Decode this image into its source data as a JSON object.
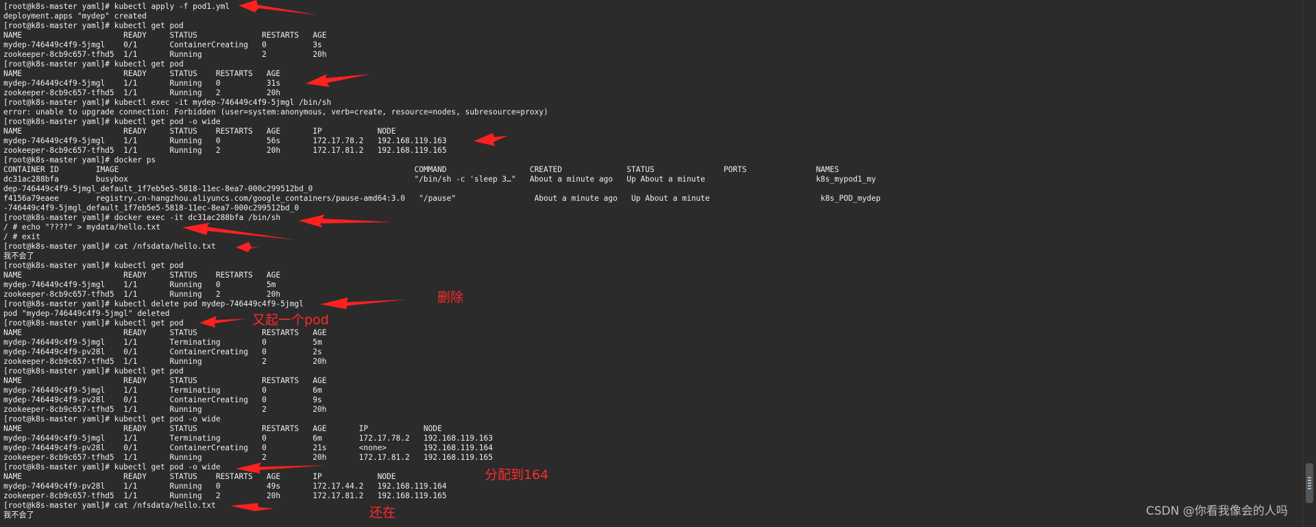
{
  "terminal": {
    "lines": [
      "[root@k8s-master yaml]# kubectl apply -f pod1.yml",
      "deployment.apps \"mydep\" created",
      "[root@k8s-master yaml]# kubectl get pod",
      "NAME                      READY     STATUS              RESTARTS   AGE",
      "mydep-746449c4f9-5jmgl    0/1       ContainerCreating   0          3s",
      "zookeeper-8cb9c657-tfhd5  1/1       Running             2          20h",
      "[root@k8s-master yaml]# kubectl get pod",
      "NAME                      READY     STATUS    RESTARTS   AGE",
      "mydep-746449c4f9-5jmgl    1/1       Running   0          31s",
      "zookeeper-8cb9c657-tfhd5  1/1       Running   2          20h",
      "[root@k8s-master yaml]# kubectl exec -it mydep-746449c4f9-5jmgl /bin/sh",
      "error: unable to upgrade connection: Forbidden (user=system:anonymous, verb=create, resource=nodes, subresource=proxy)",
      "[root@k8s-master yaml]# kubectl get pod -o wide",
      "NAME                      READY     STATUS    RESTARTS   AGE       IP            NODE",
      "mydep-746449c4f9-5jmgl    1/1       Running   0          56s       172.17.78.2   192.168.119.163",
      "zookeeper-8cb9c657-tfhd5  1/1       Running   2          20h       172.17.81.2   192.168.119.165",
      "[root@k8s-master yaml]# docker ps",
      "CONTAINER ID        IMAGE                                                                COMMAND                  CREATED              STATUS               PORTS               NAMES",
      "dc31ac288bfa        busybox                                                              \"/bin/sh -c 'sleep 3…\"   About a minute ago   Up About a minute                        k8s_mypod1_my",
      "dep-746449c4f9-5jmgl_default_1f7eb5e5-5818-11ec-8ea7-000c299512bd_0",
      "f4156a79eaee        registry.cn-hangzhou.aliyuncs.com/google_containers/pause-amd64:3.0   \"/pause\"                 About a minute ago   Up About a minute                        k8s_POD_mydep",
      "-746449c4f9-5jmgl_default_1f7eb5e5-5818-11ec-8ea7-000c299512bd_0",
      "[root@k8s-master yaml]# docker exec -it dc31ac288bfa /bin/sh",
      "/ # echo \"????\" > mydata/hello.txt",
      "/ # exit",
      "[root@k8s-master yaml]# cat /nfsdata/hello.txt",
      "我不会了",
      "[root@k8s-master yaml]# kubectl get pod",
      "NAME                      READY     STATUS    RESTARTS   AGE",
      "mydep-746449c4f9-5jmgl    1/1       Running   0          5m",
      "zookeeper-8cb9c657-tfhd5  1/1       Running   2          20h",
      "[root@k8s-master yaml]# kubectl delete pod mydep-746449c4f9-5jmgl",
      "pod \"mydep-746449c4f9-5jmgl\" deleted",
      "[root@k8s-master yaml]# kubectl get pod",
      "NAME                      READY     STATUS              RESTARTS   AGE",
      "mydep-746449c4f9-5jmgl    1/1       Terminating         0          5m",
      "mydep-746449c4f9-pv28l    0/1       ContainerCreating   0          2s",
      "zookeeper-8cb9c657-tfhd5  1/1       Running             2          20h",
      "[root@k8s-master yaml]# kubectl get pod",
      "NAME                      READY     STATUS              RESTARTS   AGE",
      "mydep-746449c4f9-5jmgl    1/1       Terminating         0          6m",
      "mydep-746449c4f9-pv28l    0/1       ContainerCreating   0          9s",
      "zookeeper-8cb9c657-tfhd5  1/1       Running             2          20h",
      "[root@k8s-master yaml]# kubectl get pod -o wide",
      "NAME                      READY     STATUS              RESTARTS   AGE       IP            NODE",
      "mydep-746449c4f9-5jmgl    1/1       Terminating         0          6m        172.17.78.2   192.168.119.163",
      "mydep-746449c4f9-pv28l    0/1       ContainerCreating   0          21s       <none>        192.168.119.164",
      "zookeeper-8cb9c657-tfhd5  1/1       Running             2          20h       172.17.81.2   192.168.119.165",
      "[root@k8s-master yaml]# kubectl get pod -o wide",
      "NAME                      READY     STATUS    RESTARTS   AGE       IP            NODE",
      "mydep-746449c4f9-pv28l    1/1       Running   0          49s       172.17.44.2   192.168.119.164",
      "zookeeper-8cb9c657-tfhd5  1/1       Running   2          20h       172.17.81.2   192.168.119.165",
      "[root@k8s-master yaml]# cat /nfsdata/hello.txt",
      "我不会了"
    ]
  },
  "annotations": {
    "delete": "删除",
    "new_pod": "又起一个pod",
    "assigned": "分配到164",
    "still_there": "还在"
  },
  "watermark": "CSDN @你看我像会的人吗",
  "colors": {
    "terminal_bg": "#2b2b2b",
    "terminal_fg": "#f0f0f0",
    "annotation_red": "#ff2a2a"
  }
}
